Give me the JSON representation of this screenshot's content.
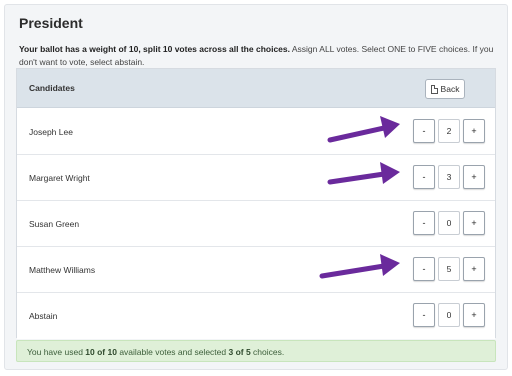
{
  "title": "President",
  "instructions": {
    "bold_part": "Your ballot has a weight of 10, split 10 votes across all the choices.",
    "rest": " Assign ALL votes. Select ONE to FIVE choices. If you don't want to vote, select abstain."
  },
  "table": {
    "header_label": "Candidates",
    "back_label": "Back",
    "minus_label": "-",
    "plus_label": "+",
    "rows": [
      {
        "name": "Joseph Lee",
        "votes": "2"
      },
      {
        "name": "Margaret Wright",
        "votes": "3"
      },
      {
        "name": "Susan Green",
        "votes": "0"
      },
      {
        "name": "Matthew Williams",
        "votes": "5"
      },
      {
        "name": "Abstain",
        "votes": "0"
      }
    ]
  },
  "status": {
    "prefix": "You have used ",
    "used": "10 of 10",
    "middle": " available votes and selected ",
    "selected": "3 of 5",
    "suffix": " choices."
  },
  "colors": {
    "arrow": "#6a2a9c",
    "header_bg": "#dbe3ea",
    "status_bg": "#dff0d8"
  }
}
